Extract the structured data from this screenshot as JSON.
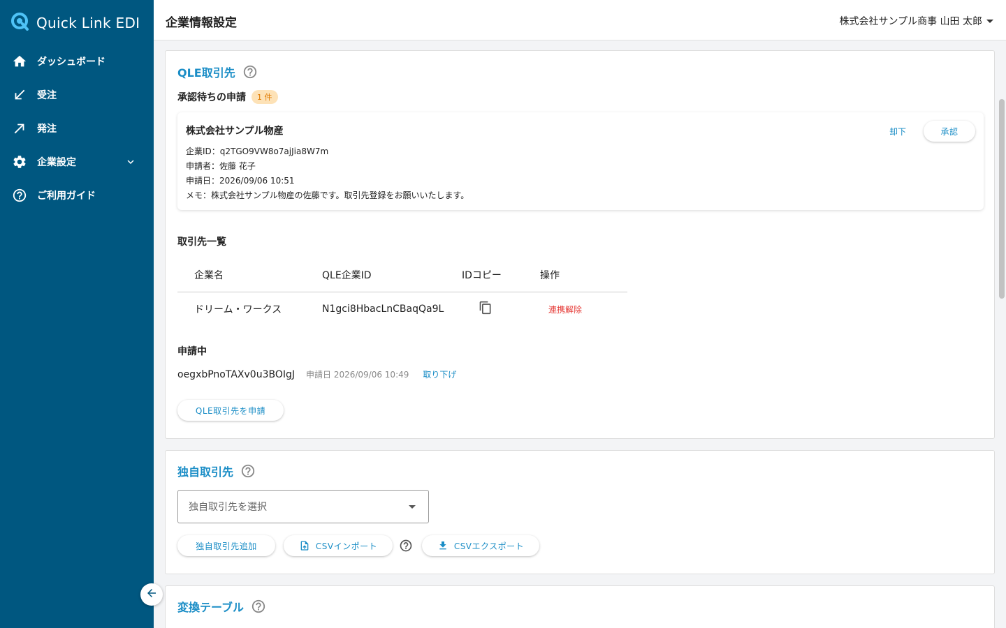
{
  "app": {
    "logo_text": "Quick Link EDI"
  },
  "sidebar": {
    "items": [
      {
        "label": "ダッシュボード",
        "icon": "home-icon"
      },
      {
        "label": "受注",
        "icon": "arrow-down-left-icon"
      },
      {
        "label": "発注",
        "icon": "arrow-up-right-icon"
      },
      {
        "label": "企業設定",
        "icon": "gear-icon",
        "expandable": true
      },
      {
        "label": "ご利用ガイド",
        "icon": "help-circle-icon"
      }
    ]
  },
  "header": {
    "title": "企業情報設定",
    "user": "株式会社サンプル商事 山田 太郎"
  },
  "qle_section": {
    "title": "QLE取引先",
    "pending_approval": {
      "heading": "承認待ちの申請",
      "count_badge": "1 件",
      "request": {
        "company": "株式会社サンプル物産",
        "company_id_line": "企業ID：q2TGO9VW8o7ajJia8W7m",
        "applicant_line": "申請者：佐藤 花子",
        "date_line": "申請日：2026/09/06 10:51",
        "memo_line": "メモ：株式会社サンプル物産の佐藤です。取引先登録をお願いいたします。",
        "reject_label": "却下",
        "approve_label": "承認"
      }
    },
    "partners": {
      "heading": "取引先一覧",
      "columns": [
        "企業名",
        "QLE企業ID",
        "IDコピー",
        "操作"
      ],
      "rows": [
        {
          "name": "ドリーム・ワークス",
          "qle_id": "N1gci8HbacLnCBaqQa9L",
          "action": "連携解除"
        }
      ]
    },
    "applying": {
      "heading": "申請中",
      "id": "oegxbPnoTAXv0u3BOIgJ",
      "date": "申請日 2026/09/06 10:49",
      "cancel_label": "取り下げ"
    },
    "apply_button": "QLE取引先を申請"
  },
  "custom_section": {
    "title": "独自取引先",
    "select_placeholder": "独自取引先を選択",
    "add_button": "独自取引先追加",
    "import_button": "CSVインポート",
    "export_button": "CSVエクスポート"
  },
  "conversion_section": {
    "title": "変換テーブル"
  },
  "colors": {
    "sidebar": "#005780",
    "accent": "#1a8dc6",
    "danger": "#e53935",
    "badge_bg": "#fde2b7",
    "badge_text": "#e07a00"
  }
}
